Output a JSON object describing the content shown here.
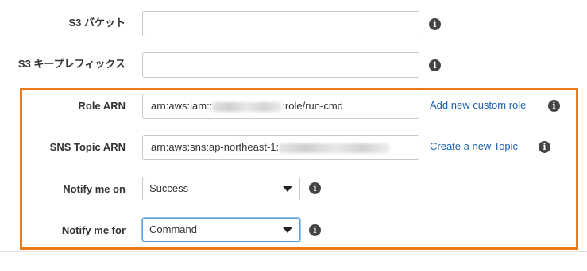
{
  "s3_bucket": {
    "label": "S3 バケット",
    "value": ""
  },
  "s3_key_prefix": {
    "label": "S3 キープレフィックス",
    "value": ""
  },
  "role_arn": {
    "label": "Role ARN",
    "value_prefix": "arn:aws:iam::",
    "value_suffix": ":role/run-cmd",
    "link": "Add new custom role"
  },
  "sns_topic_arn": {
    "label": "SNS Topic ARN",
    "value_prefix": "arn:aws:sns:ap-northeast-1:",
    "link": "Create a new Topic"
  },
  "notify_me_on": {
    "label": "Notify me on",
    "selected": "Success"
  },
  "notify_me_for": {
    "label": "Notify me for",
    "selected": "Command"
  },
  "info_icon_glyph": "i",
  "colors": {
    "highlight_border": "#eb7a19",
    "link": "#1a5fb4",
    "focus_border": "#5b9dd9"
  }
}
